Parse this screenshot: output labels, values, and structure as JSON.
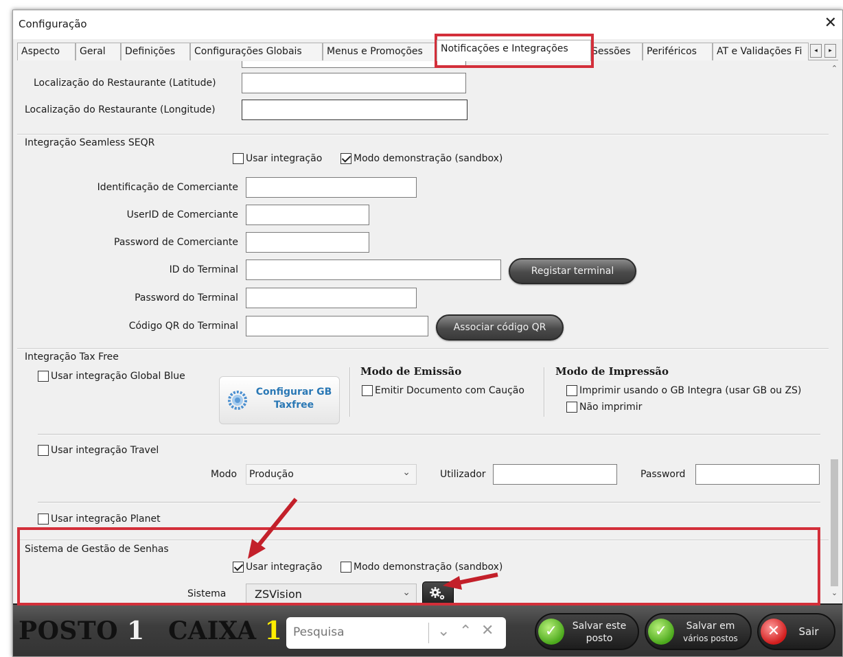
{
  "window": {
    "title": "Configuração",
    "close_glyph": "✕"
  },
  "tabs": [
    {
      "label": "Aspecto"
    },
    {
      "label": "Geral"
    },
    {
      "label": "Definições"
    },
    {
      "label": "Configurações Globais"
    },
    {
      "label": "Menus e Promoções"
    },
    {
      "label": "Notificações e Integrações",
      "active": true
    },
    {
      "label": "Sessões"
    },
    {
      "label": "Periféricos"
    },
    {
      "label": "AT e Validações Fi"
    }
  ],
  "tab_scroll": {
    "left": "◂",
    "right": "▸"
  },
  "location": {
    "latitude_label": "Localização do Restaurante (Latitude)",
    "latitude_value": "",
    "longitude_label": "Localização do Restaurante (Longitude)",
    "longitude_value": ""
  },
  "seqr": {
    "title": "Integração Seamless SEQR",
    "use_integration_label": "Usar integração",
    "use_integration_checked": false,
    "demo_mode_label": "Modo demonstração (sandbox)",
    "demo_mode_checked": true,
    "merchant_id_label": "Identificação de Comerciante",
    "merchant_id_value": "",
    "merchant_userid_label": "UserID de Comerciante",
    "merchant_userid_value": "",
    "merchant_password_label": "Password de Comerciante",
    "merchant_password_value": "",
    "terminal_id_label": "ID do Terminal",
    "terminal_id_value": "",
    "register_terminal_button": "Registar terminal",
    "terminal_password_label": "Password do Terminal",
    "terminal_password_value": "",
    "terminal_qr_label": "Código QR do Terminal",
    "terminal_qr_value": "",
    "associate_qr_button": "Associar código QR"
  },
  "taxfree": {
    "title": "Integração Tax Free",
    "global_blue_label": "Usar integração Global Blue",
    "global_blue_checked": false,
    "configure_gb_line1": "Configurar GB",
    "configure_gb_line2": "Taxfree",
    "emission_title": "Modo de Emissão",
    "emission_option": "Emitir Documento com Caução",
    "emission_checked": false,
    "print_title": "Modo de Impressão",
    "print_option1": "Imprimir usando o GB Integra  (usar GB ou ZS)",
    "print_option1_checked": false,
    "print_option2": "Não imprimir",
    "print_option2_checked": false,
    "travel_label": "Usar integração Travel",
    "travel_checked": false,
    "mode_label": "Modo",
    "mode_value": "Produção",
    "user_label": "Utilizador",
    "user_value": "",
    "password_label": "Password",
    "password_value": "",
    "planet_label": "Usar integração Planet",
    "planet_checked": false
  },
  "queue": {
    "title": "Sistema de Gestão de Senhas",
    "use_integration_label": "Usar integração",
    "use_integration_checked": true,
    "demo_mode_label": "Modo demonstração (sandbox)",
    "demo_mode_checked": false,
    "system_label": "Sistema",
    "system_value": "ZSVision"
  },
  "bottom": {
    "posto_label": "POSTO",
    "posto_number": "1",
    "caixa_label": "CAIXA",
    "caixa_number": "1",
    "search_placeholder": "Pesquisa",
    "save_station_line1": "Salvar este",
    "save_station_line2": "posto",
    "save_multi_line1": "Salvar em",
    "save_multi_line2": "vários postos",
    "exit_label": "Sair"
  },
  "colors": {
    "highlight_red": "#d32f3a",
    "caixa_number": "#ffee00",
    "save_green": "#4ba81c",
    "exit_red": "#d11c1c"
  }
}
